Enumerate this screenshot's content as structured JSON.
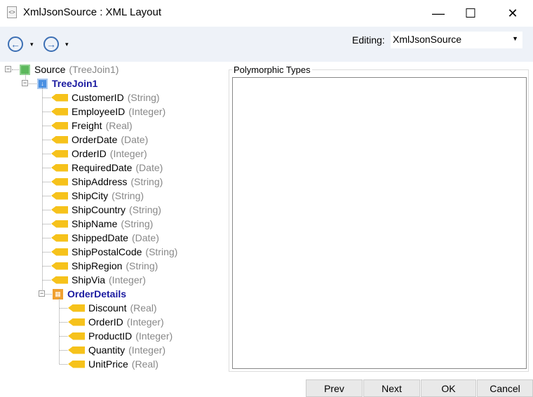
{
  "window": {
    "title": "XmlJsonSource : XML Layout",
    "minimize": "—",
    "maximize": "☐",
    "close": "✕"
  },
  "toolbar": {
    "back": "←",
    "forward": "→",
    "dropdown": "▾",
    "editing_label": "Editing:",
    "editing_value": "XmlJsonSource"
  },
  "tree": {
    "root": {
      "name": "Source",
      "type": "(TreeJoin1)"
    },
    "join": {
      "name": "TreeJoin1"
    },
    "fields": [
      {
        "name": "CustomerID",
        "type": "(String)"
      },
      {
        "name": "EmployeeID",
        "type": "(Integer)"
      },
      {
        "name": "Freight",
        "type": "(Real)"
      },
      {
        "name": "OrderDate",
        "type": "(Date)"
      },
      {
        "name": "OrderID",
        "type": "(Integer)"
      },
      {
        "name": "RequiredDate",
        "type": "(Date)"
      },
      {
        "name": "ShipAddress",
        "type": "(String)"
      },
      {
        "name": "ShipCity",
        "type": "(String)"
      },
      {
        "name": "ShipCountry",
        "type": "(String)"
      },
      {
        "name": "ShipName",
        "type": "(String)"
      },
      {
        "name": "ShippedDate",
        "type": "(Date)"
      },
      {
        "name": "ShipPostalCode",
        "type": "(String)"
      },
      {
        "name": "ShipRegion",
        "type": "(String)"
      },
      {
        "name": "ShipVia",
        "type": "(Integer)"
      }
    ],
    "details": {
      "name": "OrderDetails"
    },
    "detail_fields": [
      {
        "name": "Discount",
        "type": "(Real)"
      },
      {
        "name": "OrderID",
        "type": "(Integer)"
      },
      {
        "name": "ProductID",
        "type": "(Integer)"
      },
      {
        "name": "Quantity",
        "type": "(Integer)"
      },
      {
        "name": "UnitPrice",
        "type": "(Real)"
      }
    ]
  },
  "panel": {
    "title": "Polymorphic Types"
  },
  "buttons": {
    "prev": "Prev",
    "next": "Next",
    "ok": "OK",
    "cancel": "Cancel"
  }
}
